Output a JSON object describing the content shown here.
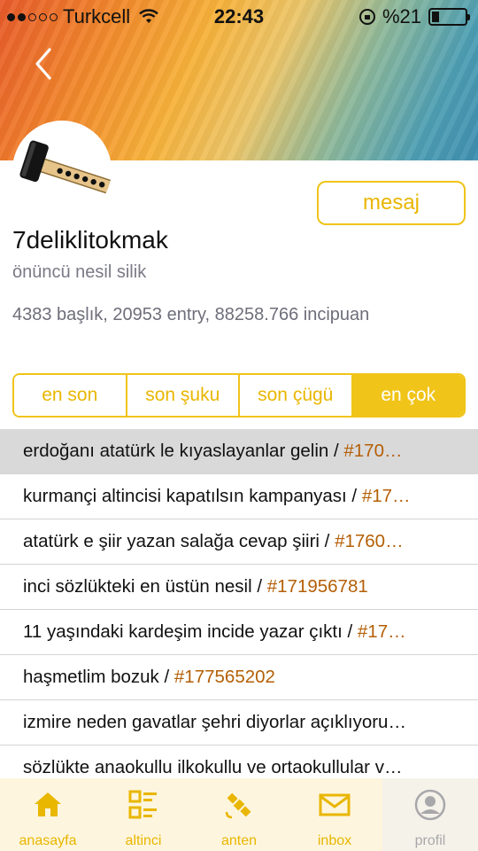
{
  "status_bar": {
    "carrier": "Turkcell",
    "time": "22:43",
    "battery": "%21",
    "battery_level": 0.21,
    "signal_bars": 2
  },
  "profile": {
    "username": "7deliklitokmak",
    "rank": "önüncü nesil silik",
    "stats": "4383 başlık, 20953 entry, 88258.766 incipuan",
    "message_label": "mesaj",
    "avatar_icon": "hammer-icon"
  },
  "tabs": [
    {
      "label": "en son",
      "active": false
    },
    {
      "label": "son şuku",
      "active": false
    },
    {
      "label": "son çügü",
      "active": false
    },
    {
      "label": "en çok",
      "active": true
    }
  ],
  "entries": [
    {
      "title": "erdoğanı atatürk le kıyaslayanlar gelin / ",
      "id": "#170…",
      "selected": true
    },
    {
      "title": "kurmançi altincisi kapatılsın kampanyası / ",
      "id": "#17…",
      "selected": false
    },
    {
      "title": "atatürk e şiir yazan salağa cevap şiiri / ",
      "id": "#1760…",
      "selected": false
    },
    {
      "title": "inci sözlükteki en üstün nesil / ",
      "id": "#171956781",
      "selected": false
    },
    {
      "title": "11 yaşındaki kardeşim incide yazar çıktı / ",
      "id": "#17…",
      "selected": false
    },
    {
      "title": "haşmetlim bozuk / ",
      "id": "#177565202",
      "selected": false
    },
    {
      "title": "izmire neden gavatlar şehri diyorlar açıklıyoru…",
      "id": "",
      "selected": false
    },
    {
      "title": "sözlükte anaokullu ilkokullu ve ortaokullular v…",
      "id": "",
      "selected": false
    }
  ],
  "bottom_nav": [
    {
      "label": "anasayfa",
      "icon": "home-icon"
    },
    {
      "label": "altinci",
      "icon": "list-icon"
    },
    {
      "label": "anten",
      "icon": "satellite-icon"
    },
    {
      "label": "inbox",
      "icon": "mail-icon"
    },
    {
      "label": "profil",
      "icon": "profile-icon"
    }
  ],
  "colors": {
    "accent": "#f0c419",
    "accent_text": "#e9b600",
    "entry_id": "#b45f06",
    "nav_background": "#fdf5dd"
  }
}
